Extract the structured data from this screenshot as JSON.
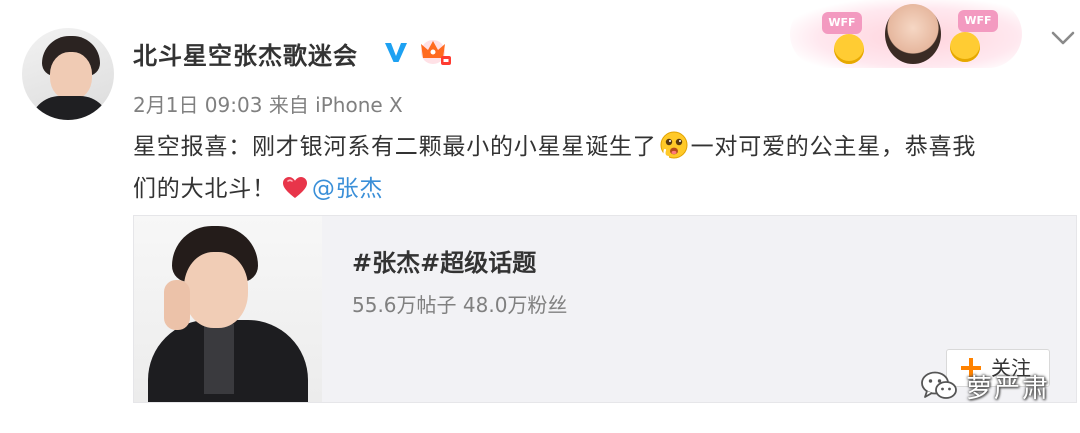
{
  "post": {
    "username": "北斗星空张杰歌迷会",
    "date": "2月1日 09:03",
    "source_prefix": "来自",
    "source_device": "iPhone X",
    "text_line1_a": "星空报喜：刚才银河系有二颗最小的小星星诞生了",
    "text_line1_b": "一对可爱的公主星，恭喜我",
    "text_line2": "们的大北斗！",
    "mention": "@张杰"
  },
  "header_decor": {
    "badge_text": "WFF"
  },
  "card": {
    "title": "#张杰#超级话题",
    "stats": "55.6万帖子 48.0万粉丝",
    "follow_label": "关注"
  },
  "watermark": {
    "text": "萝严肃"
  },
  "icons": {
    "verified": "verified-v-icon",
    "crown": "crown-vip-icon",
    "chevron": "chevron-down-icon",
    "emoji": "drooling-face-emoji",
    "heart": "heart-icon",
    "plus": "plus-icon",
    "wechat": "wechat-icon"
  },
  "colors": {
    "accent_orange": "#ff8200",
    "verified_blue": "#1da1f2",
    "mention_blue": "#3a8fd8",
    "heart_red": "#e8354a",
    "meta_gray": "#808080",
    "card_bg": "#f2f2f5"
  }
}
